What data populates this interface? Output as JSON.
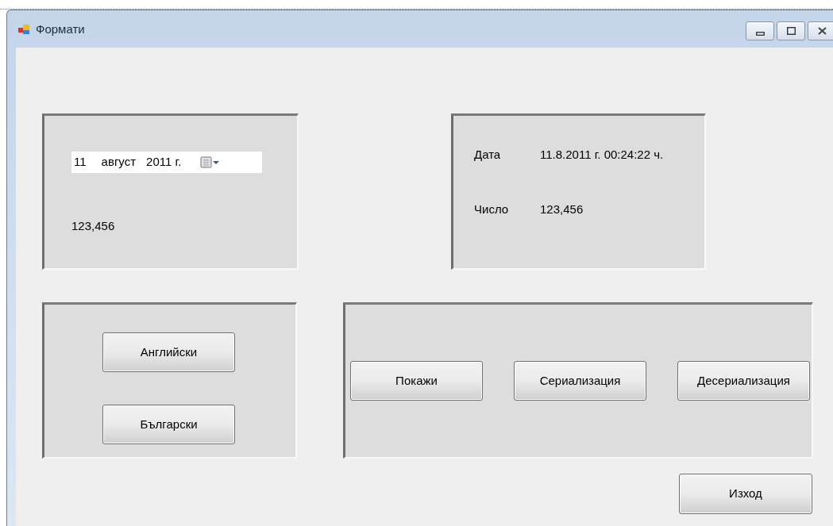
{
  "window": {
    "title": "Формати"
  },
  "date_picker": {
    "day": "11",
    "month": "август",
    "year": "2011 г."
  },
  "number_label": "123,456",
  "info": [
    {
      "label": "Дата",
      "value": "11.8.2011 г. 00:24:22 ч."
    },
    {
      "label": "Число",
      "value": "123,456"
    }
  ],
  "language_buttons": [
    "Английски",
    "Български"
  ],
  "action_buttons": [
    "Покажи",
    "Сериализация",
    "Десериализация"
  ],
  "exit_button": "Изход"
}
